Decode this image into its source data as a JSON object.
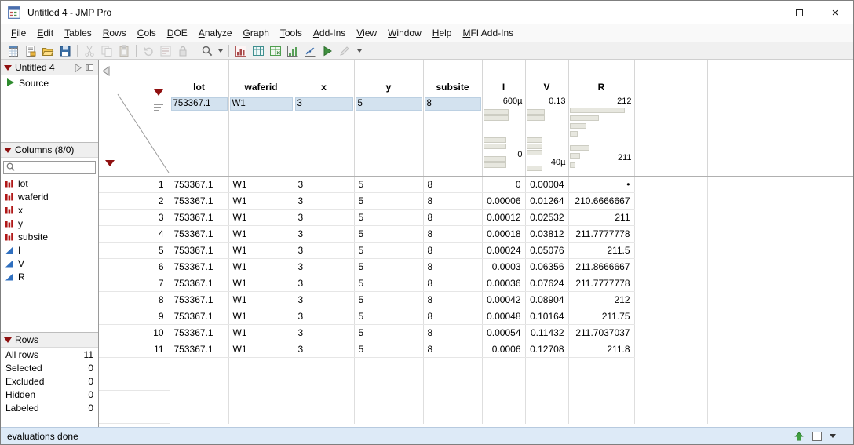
{
  "window": {
    "title": "Untitled 4 - JMP Pro"
  },
  "menubar": {
    "items": [
      "File",
      "Edit",
      "Tables",
      "Rows",
      "Cols",
      "DOE",
      "Analyze",
      "Graph",
      "Tools",
      "Add-Ins",
      "View",
      "Window",
      "Help",
      "MFI Add-Ins"
    ]
  },
  "toolbar": {
    "groups": [
      [
        {
          "name": "new-data-table"
        },
        {
          "name": "new-journal"
        },
        {
          "name": "open-file"
        },
        {
          "name": "save-file"
        }
      ],
      [
        {
          "name": "cut",
          "disabled": true
        },
        {
          "name": "copy",
          "disabled": true
        },
        {
          "name": "paste",
          "disabled": true
        }
      ],
      [
        {
          "name": "undo",
          "disabled": true
        },
        {
          "name": "recode",
          "disabled": true
        },
        {
          "name": "lock",
          "disabled": true
        }
      ],
      [
        {
          "name": "zoom",
          "caret": true
        }
      ],
      [
        {
          "name": "distribution"
        },
        {
          "name": "tabulate"
        },
        {
          "name": "formula"
        },
        {
          "name": "graph-builder"
        },
        {
          "name": "fit-y-by-x"
        },
        {
          "name": "run-script"
        },
        {
          "name": "annotate",
          "disabled": true
        }
      ]
    ]
  },
  "sidebar": {
    "table_panel": {
      "title": "Untitled 4",
      "source_item": "Source"
    },
    "columns_panel": {
      "title": "Columns (8/0)",
      "search_placeholder": "",
      "items": [
        {
          "name": "lot",
          "type": "nominal"
        },
        {
          "name": "waferid",
          "type": "nominal"
        },
        {
          "name": "x",
          "type": "nominal"
        },
        {
          "name": "y",
          "type": "nominal"
        },
        {
          "name": "subsite",
          "type": "nominal"
        },
        {
          "name": "I",
          "type": "continuous"
        },
        {
          "name": "V",
          "type": "continuous"
        },
        {
          "name": "R",
          "type": "continuous"
        }
      ]
    },
    "rows_panel": {
      "title": "Rows",
      "stats": [
        {
          "label": "All rows",
          "value": "11"
        },
        {
          "label": "Selected",
          "value": "0"
        },
        {
          "label": "Excluded",
          "value": "0"
        },
        {
          "label": "Hidden",
          "value": "0"
        },
        {
          "label": "Labeled",
          "value": "0"
        }
      ]
    }
  },
  "table": {
    "columns": [
      {
        "label": "lot",
        "kind": "categorical",
        "preview": "753367.1"
      },
      {
        "label": "waferid",
        "kind": "categorical",
        "preview": "W1"
      },
      {
        "label": "x",
        "kind": "categorical",
        "preview": "3"
      },
      {
        "label": "y",
        "kind": "categorical",
        "preview": "5"
      },
      {
        "label": "subsite",
        "kind": "categorical",
        "preview": "8"
      },
      {
        "label": "I",
        "kind": "continuous",
        "graph": {
          "top": "600µ",
          "bottom": "0",
          "bottom_label_y": 70,
          "bars": [
            [
              18,
              0.72
            ],
            [
              26,
              0.72
            ],
            [
              54,
              0.64
            ],
            [
              62,
              0.64
            ],
            [
              78,
              0.64
            ],
            [
              86,
              0.64
            ]
          ]
        }
      },
      {
        "label": "V",
        "kind": "continuous",
        "graph": {
          "top": "0.13",
          "bottom": "40µ",
          "bottom_label_y": 80,
          "bars": [
            [
              18,
              0.5
            ],
            [
              26,
              0.5
            ],
            [
              54,
              0.45
            ],
            [
              62,
              0.45
            ],
            [
              70,
              0.45
            ],
            [
              90,
              0.45
            ]
          ]
        }
      },
      {
        "label": "R",
        "kind": "continuous",
        "graph": {
          "top": "212",
          "bottom": "211",
          "bottom_label_y": 74,
          "bars": [
            [
              16,
              0.95
            ],
            [
              26,
              0.5
            ],
            [
              36,
              0.28
            ],
            [
              46,
              0.14
            ],
            [
              64,
              0.34
            ],
            [
              74,
              0.18
            ],
            [
              86,
              0.1
            ]
          ]
        }
      }
    ],
    "rows": [
      [
        "1",
        "753367.1",
        "W1",
        "3",
        "5",
        "8",
        "0",
        "0.00004",
        "•"
      ],
      [
        "2",
        "753367.1",
        "W1",
        "3",
        "5",
        "8",
        "0.00006",
        "0.01264",
        "210.6666667"
      ],
      [
        "3",
        "753367.1",
        "W1",
        "3",
        "5",
        "8",
        "0.00012",
        "0.02532",
        "211"
      ],
      [
        "4",
        "753367.1",
        "W1",
        "3",
        "5",
        "8",
        "0.00018",
        "0.03812",
        "211.7777778"
      ],
      [
        "5",
        "753367.1",
        "W1",
        "3",
        "5",
        "8",
        "0.00024",
        "0.05076",
        "211.5"
      ],
      [
        "6",
        "753367.1",
        "W1",
        "3",
        "5",
        "8",
        "0.0003",
        "0.06356",
        "211.8666667"
      ],
      [
        "7",
        "753367.1",
        "W1",
        "3",
        "5",
        "8",
        "0.00036",
        "0.07624",
        "211.7777778"
      ],
      [
        "8",
        "753367.1",
        "W1",
        "3",
        "5",
        "8",
        "0.00042",
        "0.08904",
        "212"
      ],
      [
        "9",
        "753367.1",
        "W1",
        "3",
        "5",
        "8",
        "0.00048",
        "0.10164",
        "211.75"
      ],
      [
        "10",
        "753367.1",
        "W1",
        "3",
        "5",
        "8",
        "0.00054",
        "0.11432",
        "211.7037037"
      ],
      [
        "11",
        "753367.1",
        "W1",
        "3",
        "5",
        "8",
        "0.0006",
        "0.12708",
        "211.8"
      ]
    ],
    "empty_row_count": 4
  },
  "statusbar": {
    "text": "evaluations done"
  },
  "colors": {
    "red_triangle": "#8f1010",
    "header_preview_bg": "#d3e2ef",
    "graph_bar_fill": "#e7e7df",
    "status_bg": "#ddeaf7",
    "continuous_icon_blue": "#2f6fbf",
    "nominal_icon_red": "#b01818",
    "source_icon_green": "#2e8b2e"
  }
}
